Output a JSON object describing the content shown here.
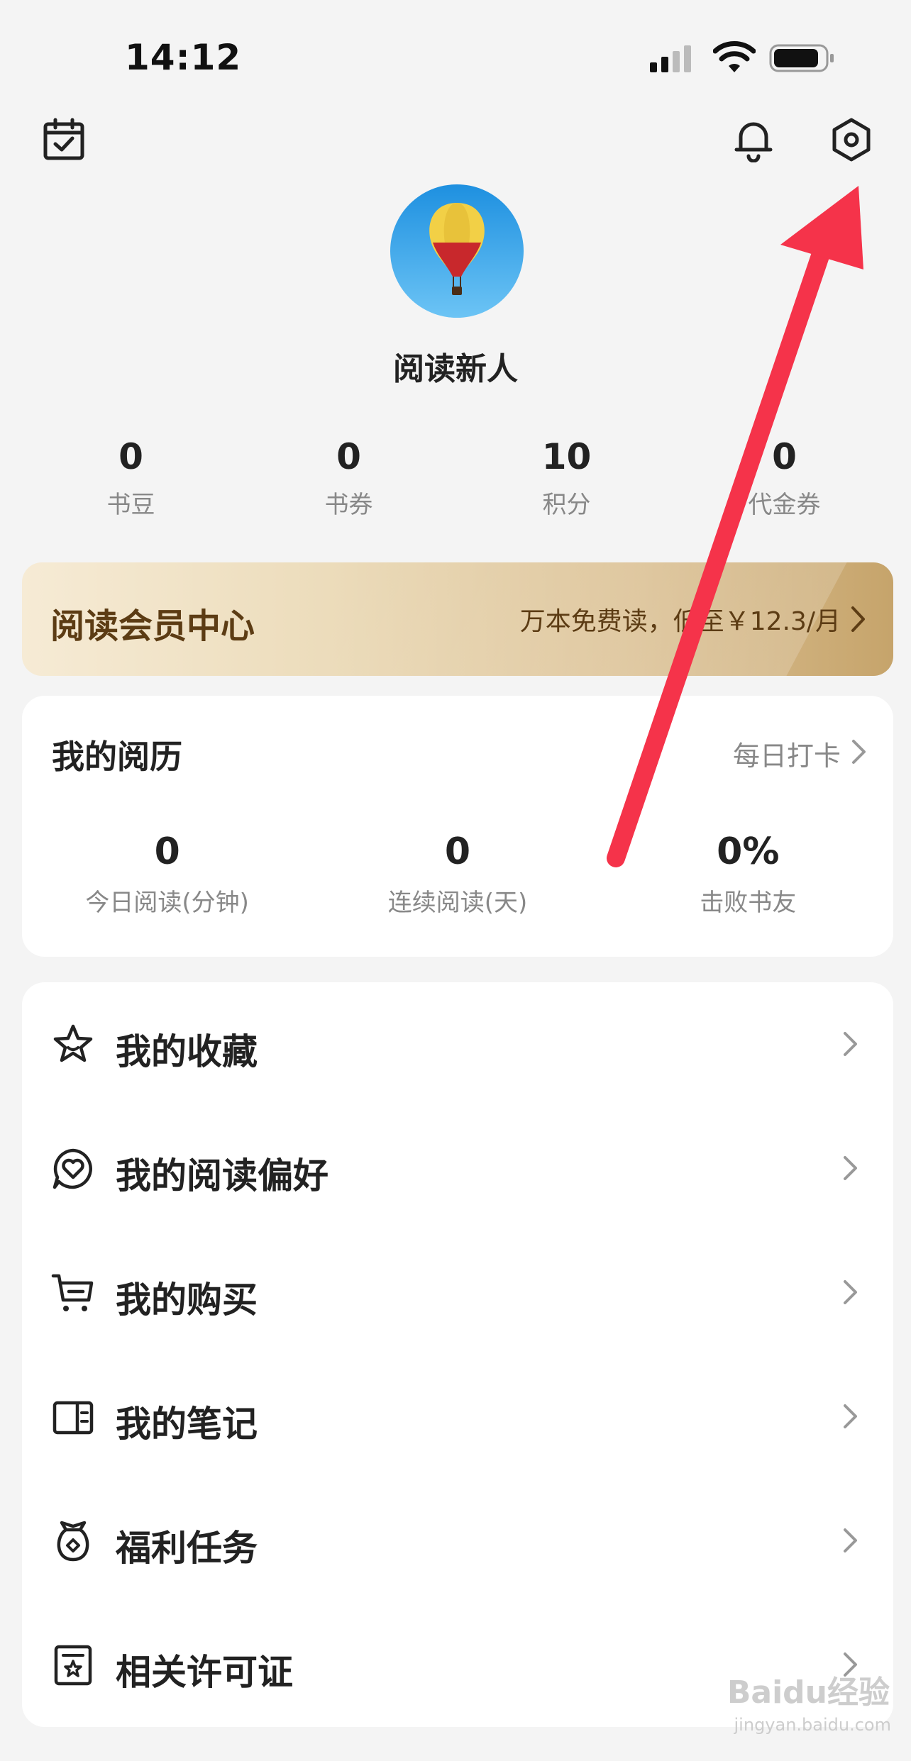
{
  "status_bar": {
    "time": "14:12"
  },
  "profile": {
    "username": "阅读新人"
  },
  "stats": [
    {
      "value": "0",
      "label": "书豆"
    },
    {
      "value": "0",
      "label": "书券"
    },
    {
      "value": "10",
      "label": "积分"
    },
    {
      "value": "0",
      "label": "代金券"
    }
  ],
  "vip": {
    "title": "阅读会员中心",
    "desc": "万本免费读，低至￥12.3/月"
  },
  "history": {
    "title": "我的阅历",
    "checkin": "每日打卡",
    "stats": [
      {
        "value": "0",
        "label": "今日阅读(分钟)"
      },
      {
        "value": "0",
        "label": "连续阅读(天)"
      },
      {
        "value": "0%",
        "label": "击败书友"
      }
    ]
  },
  "menu": [
    {
      "label": "我的收藏",
      "icon": "star-icon"
    },
    {
      "label": "我的阅读偏好",
      "icon": "heart-chat-icon"
    },
    {
      "label": "我的购买",
      "icon": "cart-icon"
    },
    {
      "label": "我的笔记",
      "icon": "notebook-icon"
    },
    {
      "label": "福利任务",
      "icon": "gift-bag-icon"
    },
    {
      "label": "相关许可证",
      "icon": "license-icon"
    }
  ],
  "watermark": {
    "text": "Baidu经验",
    "sub": "jingyan.baidu.com"
  },
  "colors": {
    "accent_arrow": "#f5334a",
    "vip_text": "#5c3c14"
  }
}
